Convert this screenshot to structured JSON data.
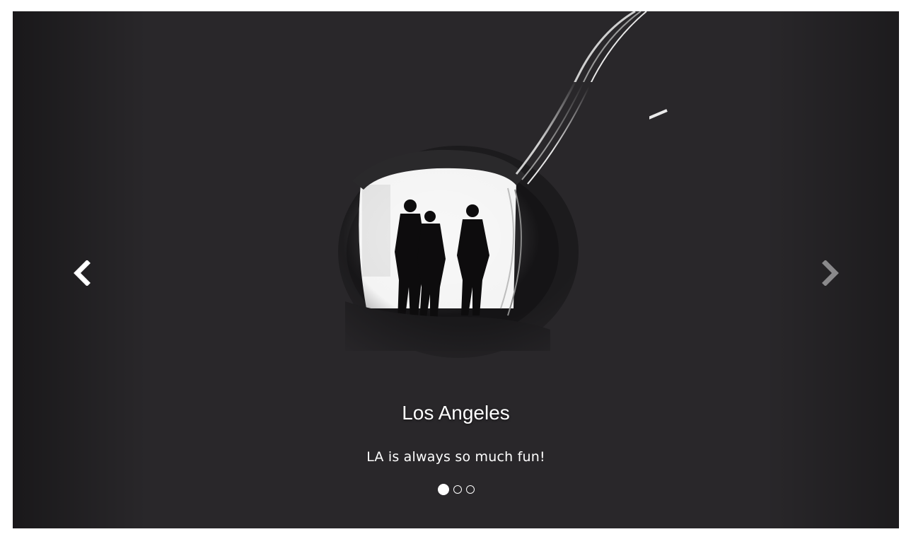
{
  "carousel": {
    "slide": {
      "title": "Los Angeles",
      "text": "LA is always so much fun!",
      "image_icon": "tunnel-silhouette-photo"
    },
    "controls": {
      "prev_icon": "chevron-left-icon",
      "next_icon": "chevron-right-icon"
    },
    "indicators": {
      "count": 3,
      "active_index": 0
    },
    "colors": {
      "background": "#29272a",
      "text": "#ffffff",
      "prev_arrow": "#ffffff",
      "next_arrow": "#8a898b"
    }
  }
}
